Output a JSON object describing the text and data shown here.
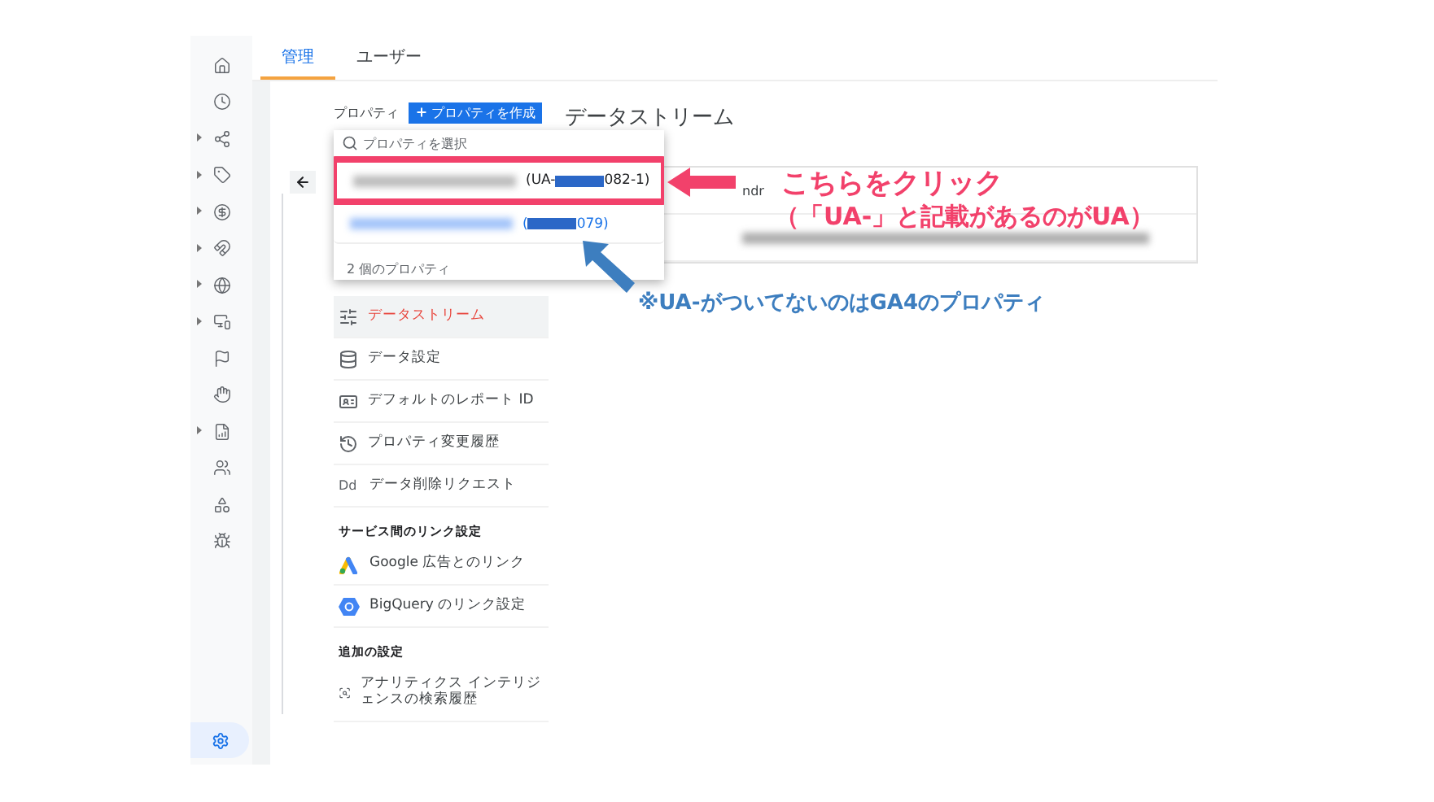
{
  "tabs": [
    {
      "label": "管理",
      "selected": true
    },
    {
      "label": "ユーザー",
      "selected": false
    }
  ],
  "property_bar": {
    "label": "プロパティ",
    "create_button": "プロパティを作成"
  },
  "heading": "データストリーム",
  "card_fragment": "ndr",
  "dropdown": {
    "search": {
      "placeholder": "プロパティを選択"
    },
    "items": [
      {
        "id_prefix": "(UA-",
        "id_suffix": "082-1)",
        "highlighted": true
      },
      {
        "id_prefix": "(",
        "id_suffix": "079)",
        "highlighted": false
      }
    ],
    "footer": "2 個のプロパティ"
  },
  "menu": [
    {
      "kind": "item",
      "label": "データストリーム",
      "selected": true
    },
    {
      "kind": "item",
      "label": "データ設定",
      "selected": false
    },
    {
      "kind": "item",
      "label": "デフォルトのレポート ID",
      "selected": false
    },
    {
      "kind": "item",
      "label": "プロパティ変更履歴",
      "selected": false
    },
    {
      "kind": "item",
      "label": "データ削除リクエスト",
      "icon_text": "Dd",
      "selected": false
    },
    {
      "kind": "section",
      "label": "サービス間のリンク設定"
    },
    {
      "kind": "item",
      "label": "Google 広告とのリンク",
      "selected": false
    },
    {
      "kind": "item",
      "label": "BigQuery のリンク設定",
      "selected": false
    },
    {
      "kind": "section",
      "label": "追加の設定"
    },
    {
      "kind": "item",
      "label": "アナリティクス インテリジェンスの検索履歴",
      "selected": false
    }
  ],
  "annotations": {
    "click_note": "こちらをクリック",
    "click_detail": "（「UA-」と記載があるのがUA）",
    "ga4_note": "※UA-がついてないのはGA4のプロパティ"
  }
}
